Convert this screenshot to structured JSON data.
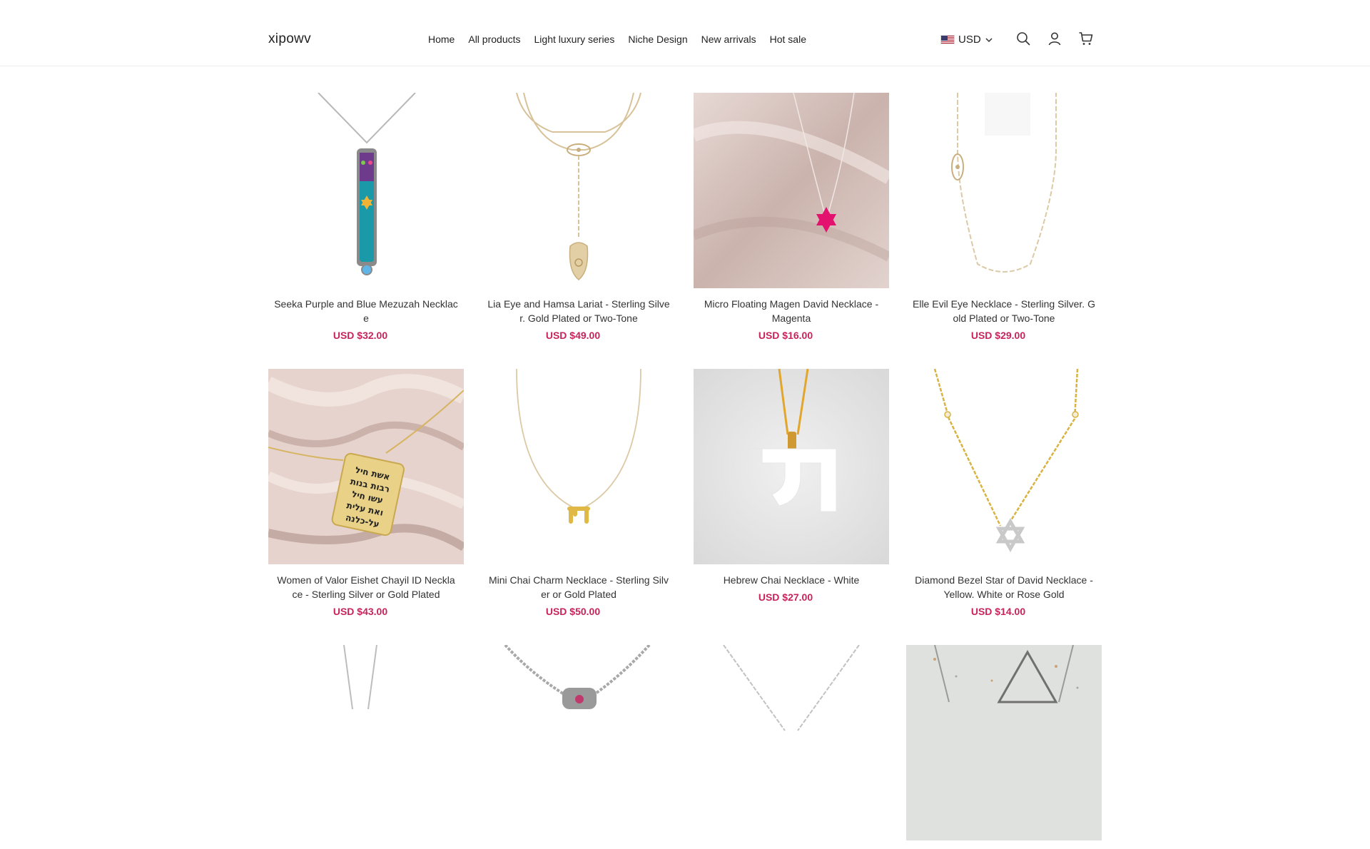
{
  "brand": "xipowv",
  "nav": [
    "Home",
    "All products",
    "Light luxury series",
    "Niche Design",
    "New arrivals",
    "Hot sale"
  ],
  "currency": {
    "label": "USD",
    "flag": "us-flag-icon"
  },
  "header_icons": [
    "search-icon",
    "user-icon",
    "cart-icon"
  ],
  "accent_color": "#c8235b",
  "products": [
    {
      "title": "Seeka Purple and Blue Mezuzah Necklace",
      "title_display": "Seeka Purple and Blue Mezuzah Necklac e",
      "price": "USD $32.00"
    },
    {
      "title": "Lia Eye and Hamsa Lariat - Sterling Silver. Gold Plated or Two-Tone",
      "title_display": "Lia Eye and Hamsa Lariat - Sterling Silve r. Gold Plated or Two-Tone",
      "price": "USD $49.00"
    },
    {
      "title": "Micro Floating Magen David Necklace - Magenta",
      "title_display": "Micro Floating Magen David Necklace - Magenta",
      "price": "USD $16.00"
    },
    {
      "title": "Elle Evil Eye Necklace - Sterling Silver. Gold Plated or Two-Tone",
      "title_display": "Elle Evil Eye Necklace - Sterling Silver. G old Plated or Two-Tone",
      "price": "USD $29.00"
    },
    {
      "title": "Women of Valor Eishet Chayil ID Necklace - Sterling Silver or Gold Plated",
      "title_display": "Women of Valor Eishet Chayil ID Neckla ce - Sterling Silver or Gold Plated",
      "price": "USD $43.00"
    },
    {
      "title": "Mini Chai Charm Necklace - Sterling Silver or Gold Plated",
      "title_display": "Mini Chai Charm Necklace - Sterling Silv er or Gold Plated",
      "price": "USD $50.00"
    },
    {
      "title": "Hebrew Chai Necklace - White",
      "title_display": "Hebrew Chai Necklace - White",
      "price": "USD $27.00"
    },
    {
      "title": "Diamond Bezel Star of David Necklace - Yellow. White or Rose Gold",
      "title_display": "Diamond Bezel Star of David Necklace - Yellow. White or Rose Gold",
      "price": "USD $14.00"
    },
    {
      "title": "",
      "title_display": "",
      "price": ""
    },
    {
      "title": "",
      "title_display": "",
      "price": ""
    },
    {
      "title": "",
      "title_display": "",
      "price": ""
    },
    {
      "title": "",
      "title_display": "",
      "price": ""
    }
  ],
  "tablet_text": "אשת חיל רבות בנות עשו חיל ואת עלית על-כלנה"
}
